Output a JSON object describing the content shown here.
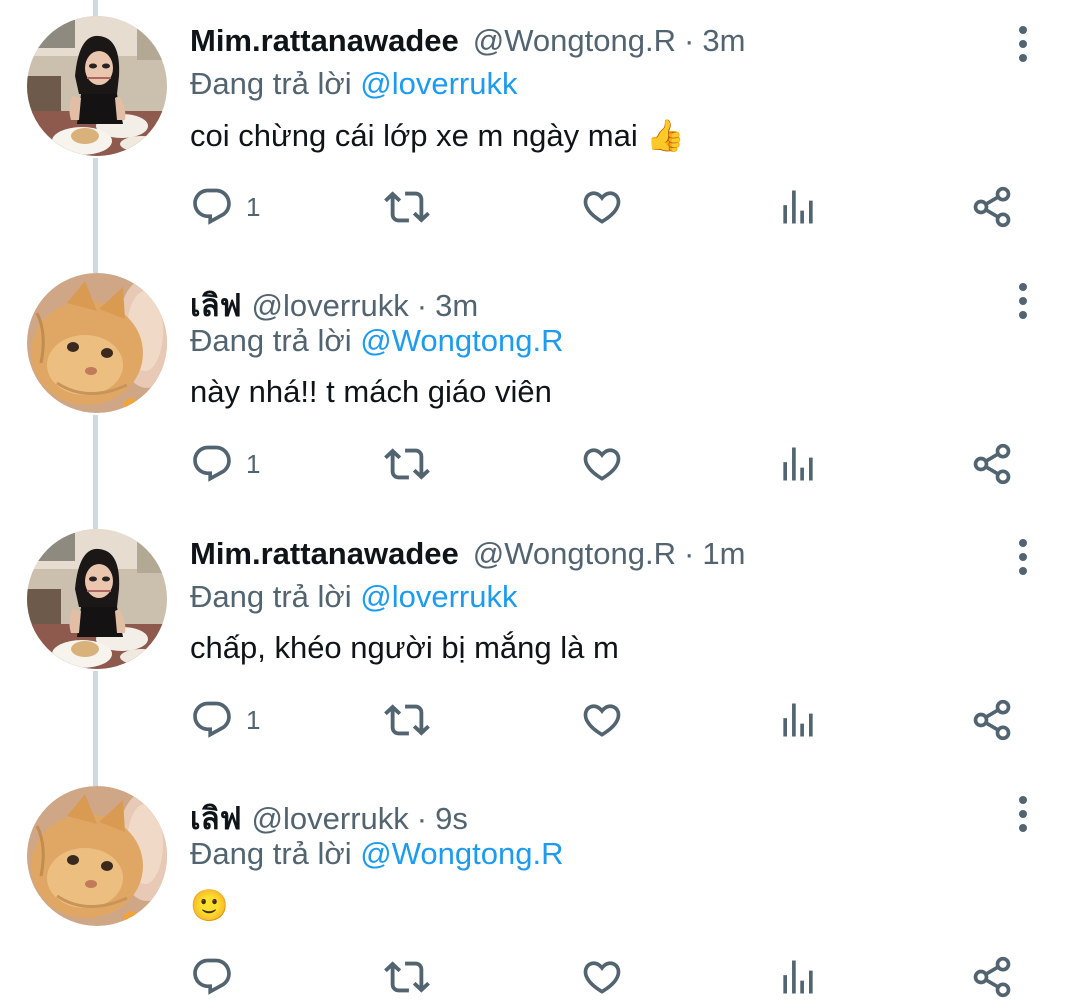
{
  "tweets": [
    {
      "name": "Mim.rattanawadee",
      "handle": "@Wongtong.R",
      "separator": "·",
      "time": "3m",
      "reply_prefix": "Đang trả lời",
      "reply_to": "@loverrukk",
      "text": "coi chừng cái lớp xe m ngày mai 👍",
      "reply_count": "1",
      "avatar": "girl-photo"
    },
    {
      "name": "เลิฟ",
      "handle": "@loverrukk",
      "separator": "·",
      "time": "3m",
      "reply_prefix": "Đang trả lời",
      "reply_to": "@Wongtong.R",
      "text": "này nhá!! t mách giáo viên",
      "reply_count": "1",
      "avatar": "cat-photo"
    },
    {
      "name": "Mim.rattanawadee",
      "handle": "@Wongtong.R",
      "separator": "·",
      "time": "1m",
      "reply_prefix": "Đang trả lời",
      "reply_to": "@loverrukk",
      "text": "chấp, khéo người bị mắng là m",
      "reply_count": "1",
      "avatar": "girl-photo"
    },
    {
      "name": "เลิฟ",
      "handle": "@loverrukk",
      "separator": "·",
      "time": "9s",
      "reply_prefix": "Đang trả lời",
      "reply_to": "@Wongtong.R",
      "text": "🙂",
      "reply_count": "",
      "avatar": "cat-photo"
    }
  ],
  "icons": [
    "reply-icon",
    "retweet-icon",
    "like-icon",
    "views-icon",
    "share-icon",
    "more-icon"
  ],
  "colors": {
    "text": "#0f1419",
    "secondary": "#536471",
    "link": "#1d9bf0",
    "thread_line": "#cfd9de"
  }
}
